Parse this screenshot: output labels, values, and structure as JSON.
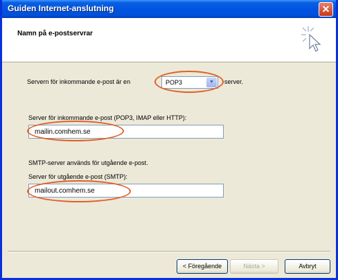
{
  "window": {
    "title": "Guiden Internet-anslutning",
    "close_glyph": "✕"
  },
  "header": {
    "title": "Namn på e-postservrar",
    "icon": "wizard-cursor-icon"
  },
  "incoming_type": {
    "prefix": "Servern för inkommande e-post är en",
    "selected": "POP3",
    "suffix": "-server."
  },
  "incoming_server": {
    "label": "Server för inkommande e-post (POP3, IMAP eller HTTP):",
    "value": "mailin.comhem.se"
  },
  "smtp_note": "SMTP-server används för utgående e-post.",
  "outgoing_server": {
    "label": "Server för utgående e-post (SMTP):",
    "value": "mailout.comhem.se"
  },
  "buttons": {
    "back": "< Föregående",
    "next": "Nästa >",
    "cancel": "Avbryt"
  },
  "colors": {
    "highlight_oval": "#e0602a",
    "titlebar": "#0054e3",
    "dialog": "#ece9d8"
  }
}
